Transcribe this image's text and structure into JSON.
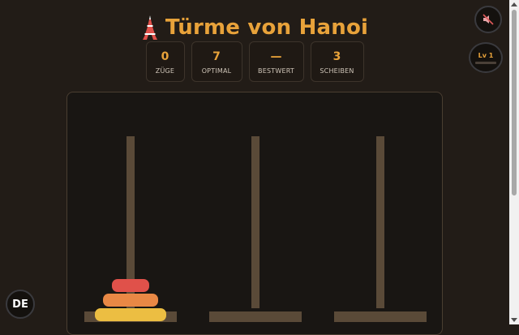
{
  "header": {
    "title": "Türme von Hanoi",
    "title_icon": "tokyo-tower-icon"
  },
  "stats": [
    {
      "value": "0",
      "label": "ZÜGE"
    },
    {
      "value": "7",
      "label": "OPTIMAL"
    },
    {
      "value": "—",
      "label": "BESTWERT"
    },
    {
      "value": "3",
      "label": "SCHEIBEN"
    }
  ],
  "controls": {
    "sound_icon": "muted-speaker-icon",
    "level_label": "Lv 1",
    "language_label": "DE"
  },
  "game": {
    "pegs": 3,
    "disks_on_peg": [
      [
        3,
        2,
        1
      ],
      [],
      []
    ],
    "disk_colors": {
      "1": "#e0514a",
      "2": "#e98845",
      "3": "#ecbe42"
    }
  },
  "colors": {
    "accent": "#e8a23a",
    "background": "#221c17",
    "board": "#191613",
    "peg": "#5a4a38"
  }
}
